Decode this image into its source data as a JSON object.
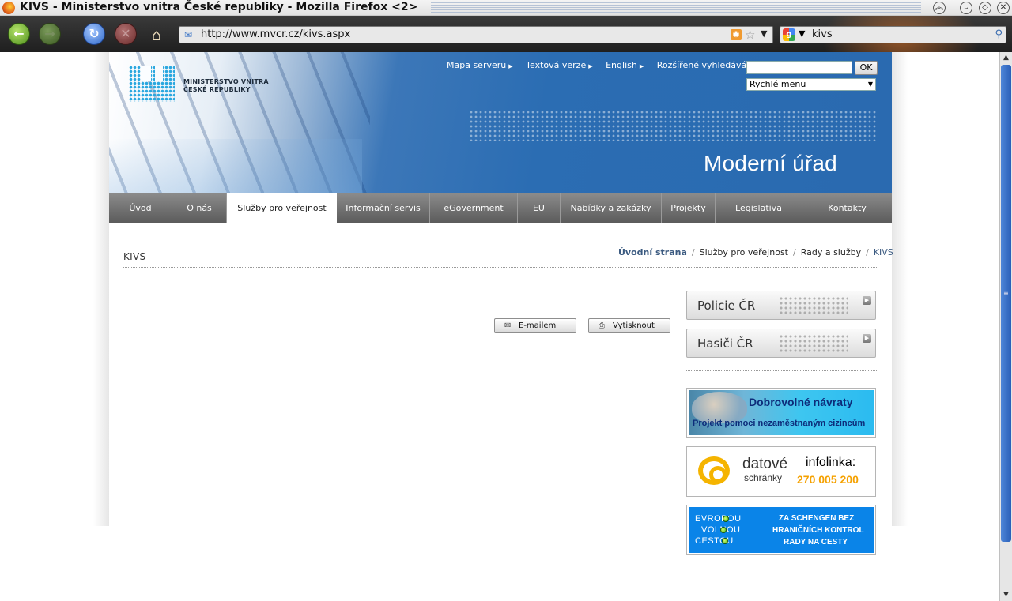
{
  "window": {
    "title": "KIVS - Ministerstvo vnitra České republiky - Mozilla Firefox <2>"
  },
  "browser": {
    "url": "http://www.mvcr.cz/kivs.aspx",
    "search_query": "kivs"
  },
  "header": {
    "logo_line1": "MINISTERSTVO VNITRA",
    "logo_line2": "ČESKÉ REPUBLIKY",
    "top_links": [
      "Mapa serveru",
      "Textová verze",
      "English",
      "Rozšířené vyhledávání"
    ],
    "search_button": "OK",
    "quick_menu": "Rychlé menu",
    "slogan": "Moderní úřad"
  },
  "nav": {
    "items": [
      "Úvod",
      "O nás",
      "Služby pro veřejnost",
      "Informační servis",
      "eGovernment",
      "EU",
      "Nabídky a zakázky",
      "Projekty",
      "Legislativa",
      "Kontakty"
    ],
    "active_index": 2
  },
  "content": {
    "title": "KIVS",
    "breadcrumb": [
      "Úvodní strana",
      "Služby pro veřejnost",
      "Rady a služby",
      "KIVS"
    ],
    "email_button": "E-mailem",
    "print_button": "Vytisknout"
  },
  "sidebar": {
    "boxes": [
      "Policie ČR",
      "Hasiči ČR"
    ],
    "banner1": {
      "title": "Dobrovolné návraty",
      "subtitle": "Projekt pomoci nezaměstnaným cizincům"
    },
    "banner2": {
      "brand_line1": "datové",
      "brand_line2": "schránky",
      "info_label": "infolinka:",
      "phone": "270 005 200"
    },
    "banner3": {
      "left_words": [
        "EVROPOU",
        "VOLNOU",
        "CESTOU"
      ],
      "right_lines": [
        "ZA SCHENGEN BEZ",
        "HRANIČNÍCH KONTROL",
        "RADY NA CESTY"
      ]
    }
  },
  "colors": {
    "header_blue": "#2a6ab0",
    "nav_gray": "#707070",
    "link_blue": "#3b5a80",
    "datove_orange": "#f5a100"
  }
}
